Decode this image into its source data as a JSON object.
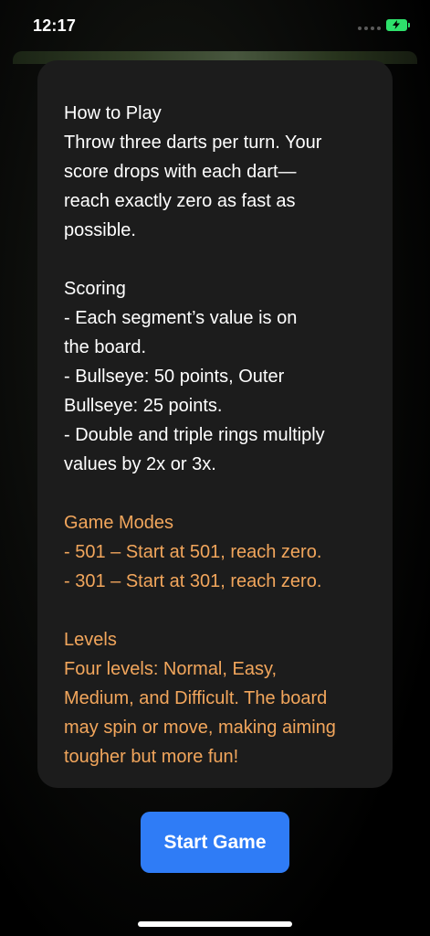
{
  "status": {
    "time": "12:17",
    "battery_color": "#2ee06b"
  },
  "rules": {
    "how_to_play_title": "How to Play",
    "how_to_play_lines": [
      "Throw three darts per turn. Your",
      "score drops with each dart—",
      "reach exactly zero as fast as",
      "possible."
    ],
    "scoring_title": "Scoring",
    "scoring_lines": [
      "- Each segment’s value is on",
      "the board.",
      "- Bullseye: 50 points, Outer",
      "Bullseye: 25 points.",
      "- Double and triple rings multiply",
      "values by 2x or 3x."
    ],
    "modes_title": "Game Modes",
    "modes_lines": [
      "- 501 – Start at 501, reach zero.",
      "- 301 – Start at 301, reach zero."
    ],
    "levels_title": "Levels",
    "levels_lines": [
      "Four levels: Normal, Easy,",
      "Medium, and Difficult. The board",
      "may spin or move, making aiming",
      "tougher but more fun!"
    ]
  },
  "start_button_label": "Start Game",
  "colors": {
    "accent_blue": "#2f7cf6",
    "highlight_orange": "#f2a65c",
    "card_bg": "#1c1c1c"
  }
}
